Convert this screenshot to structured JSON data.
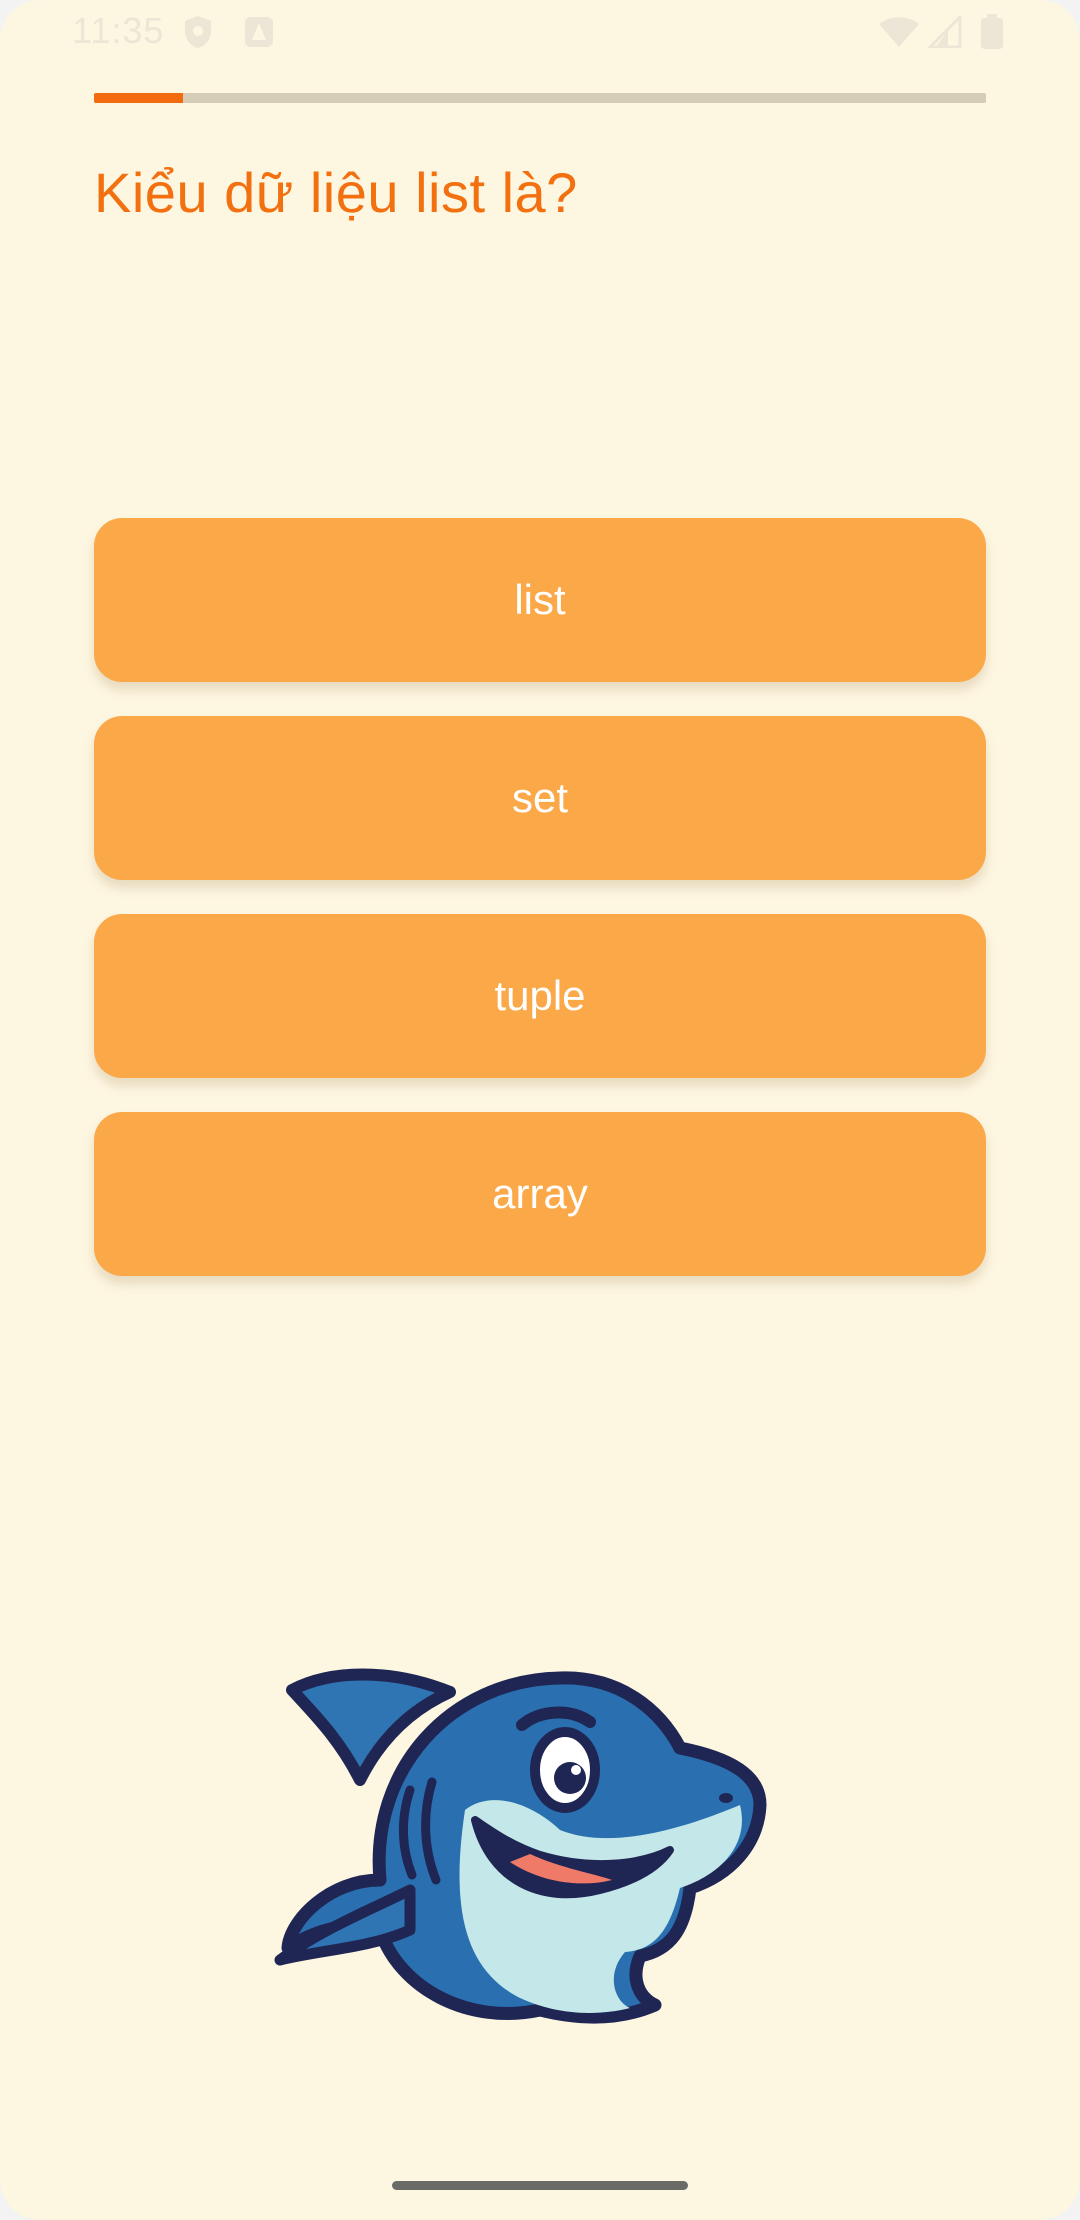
{
  "status_bar": {
    "time": "11:35",
    "icons": [
      "shield-icon",
      "notification-app-icon",
      "wifi-icon",
      "cellular-signal-icon",
      "battery-icon"
    ]
  },
  "quiz": {
    "progress": 0.1,
    "question": "Kiểu dữ liệu list là?",
    "answers": [
      "list",
      "set",
      "tuple",
      "array"
    ]
  },
  "mascot": {
    "icon": "shark-mascot-icon"
  },
  "colors": {
    "background": "#fdf6e1",
    "accent": "#f26b0f",
    "answer_button": "#fba849",
    "answer_text": "#ffffff",
    "progress_track": "#d5cdb8"
  }
}
